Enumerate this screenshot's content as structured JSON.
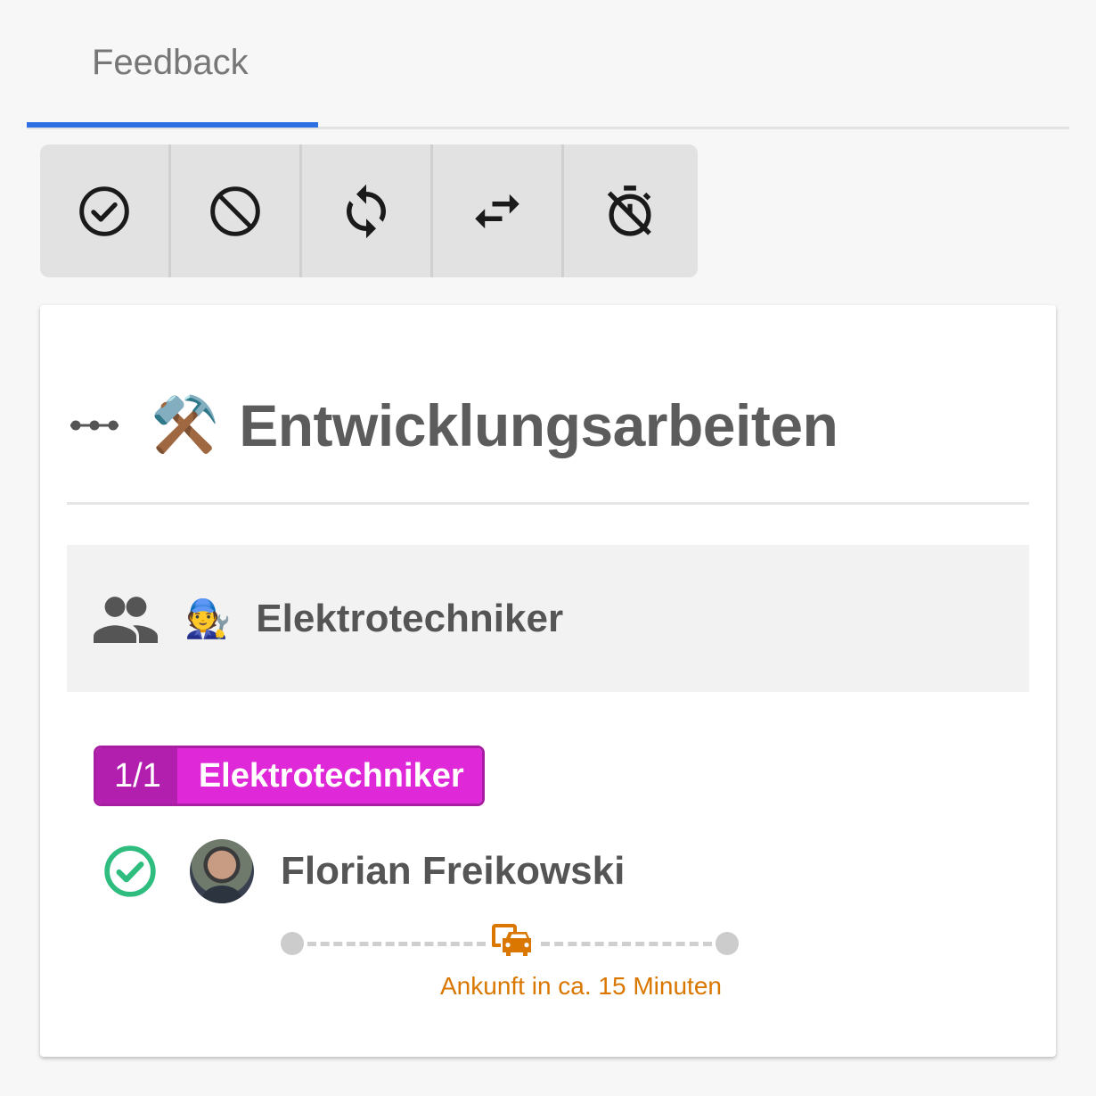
{
  "tabs": [
    {
      "label": "Feedback",
      "active": true
    }
  ],
  "toolbar": {
    "buttons": [
      {
        "name": "confirm",
        "icon": "check-circle-icon"
      },
      {
        "name": "decline",
        "icon": "block-icon"
      },
      {
        "name": "refresh",
        "icon": "sync-icon"
      },
      {
        "name": "swap",
        "icon": "swap-horiz-icon"
      },
      {
        "name": "timer-off",
        "icon": "timer-off-icon"
      }
    ]
  },
  "card": {
    "title_emoji": "⚒️",
    "title": "Entwicklungsarbeiten",
    "group": {
      "icon": "people-icon",
      "emoji": "🧑‍🔧",
      "label": "Elektrotechniker"
    },
    "role_chip": {
      "count": "1/1",
      "role": "Elektrotechniker"
    },
    "member": {
      "status_icon": "check-circle-outline-icon",
      "name": "Florian Freikowski"
    },
    "eta": {
      "icon": "car-icon",
      "text": "Ankunft in ca. 15 Minuten"
    }
  },
  "colors": {
    "tab_indicator": "#2f6fe4",
    "chip_dark": "#b21fae",
    "chip_light": "#df28d8",
    "success": "#2ebd7f",
    "eta": "#d97700"
  }
}
